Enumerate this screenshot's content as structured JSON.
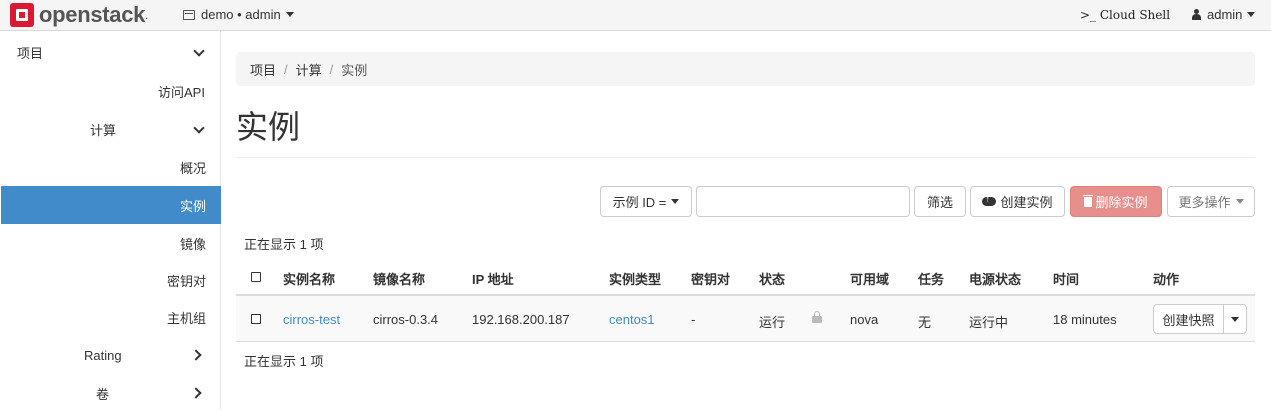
{
  "navbar": {
    "logo_text": "openstack",
    "logo_dot": ".",
    "project_selector": "demo • admin",
    "cloud_shell": ">_ Cloud Shell",
    "user": "admin"
  },
  "sidebar": {
    "project": "项目",
    "access_api": "访问API",
    "compute": "计算",
    "overview": "概况",
    "instances": "实例",
    "images": "镜像",
    "key_pairs": "密钥对",
    "server_groups": "主机组",
    "rating": "Rating",
    "volumes": "卷"
  },
  "breadcrumb": [
    "项目",
    "计算",
    "实例"
  ],
  "page_title": "实例",
  "toolbar": {
    "filter_select": "示例 ID =",
    "search_value": "",
    "filter_button": "筛选",
    "create_button": "创建实例",
    "delete_button": "删除实例",
    "more_button": "更多操作"
  },
  "count_top": "正在显示 1 项",
  "count_bottom": "正在显示 1 项",
  "table": {
    "headers": [
      "实例名称",
      "镜像名称",
      "IP 地址",
      "实例类型",
      "密钥对",
      "状态",
      "可用域",
      "任务",
      "电源状态",
      "时间",
      "动作"
    ],
    "rows": [
      {
        "name": "cirros-test",
        "image": "cirros-0.3.4",
        "ip": "192.168.200.187",
        "flavor": "centos1",
        "key_pair": "-",
        "status": "运行",
        "az": "nova",
        "task": "无",
        "power": "运行中",
        "age": "18 minutes",
        "action": "创建快照"
      }
    ]
  },
  "colors": {
    "accent": "#428bca",
    "danger": "#e68f8c",
    "brand": "#da1a32"
  }
}
